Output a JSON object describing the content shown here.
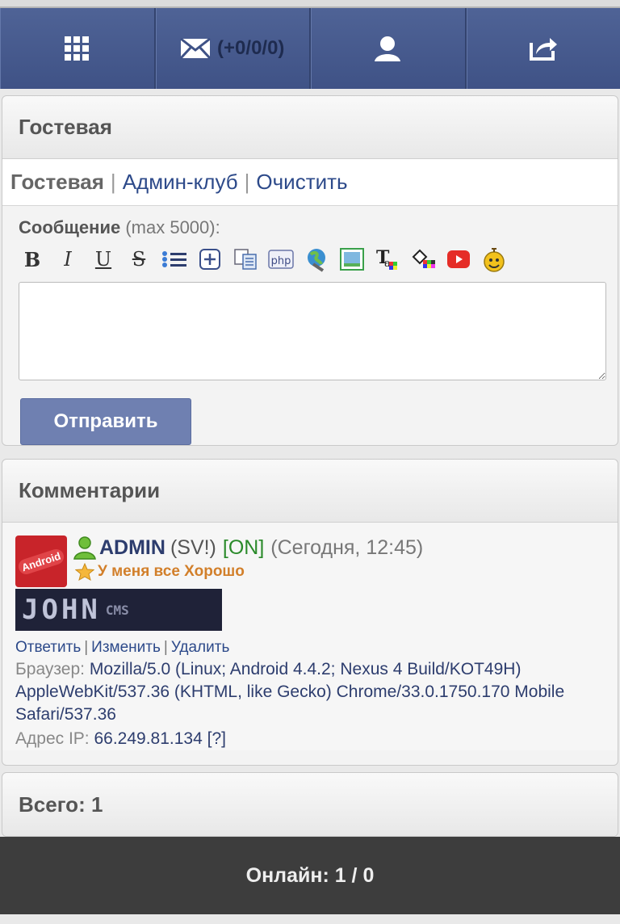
{
  "nav": {
    "mail_count": "(+0/0/0)",
    "icons": [
      "grid-icon",
      "mail-icon",
      "user-icon",
      "share-icon"
    ]
  },
  "guestbook": {
    "title": "Гостевая",
    "crumbs": {
      "current": "Гостевая",
      "separator": "|",
      "admin_club": "Админ-клуб",
      "clear": "Очистить"
    },
    "message_label": "Сообщение",
    "message_hint": "(max 5000):",
    "textarea_value": "",
    "send_label": "Отправить",
    "toolbar": [
      "bold",
      "italic",
      "underline",
      "strike",
      "list",
      "spoiler",
      "copy",
      "php",
      "url",
      "image",
      "text-color",
      "bg-color",
      "youtube",
      "smiles"
    ]
  },
  "comments": {
    "title": "Комментарии",
    "post": {
      "avatar_text": "Android",
      "nick": "ADMIN",
      "rights": "(SV!)",
      "online": "[ON]",
      "time": "(Сегодня, 12:45)",
      "status": "У меня все Хорошо",
      "banner_text": "JOHN",
      "banner_sub": "CMS",
      "reply": "Ответить",
      "edit": "Изменить",
      "delete": "Удалить",
      "sep": "|",
      "browser_label": "Браузер:",
      "browser_value": "Mozilla/5.0 (Linux; Android 4.4.2; Nexus 4 Build/KOT49H) AppleWebKit/537.36 (KHTML, like Gecko) Chrome/33.0.1750.170 Mobile Safari/537.36",
      "ip_label": "Адрес IP:",
      "ip_value": "66.249.81.134",
      "ip_link": "[?]"
    }
  },
  "total": {
    "label": "Всего: 1"
  },
  "footer": {
    "online": "Онлайн: 1 / 0"
  }
}
